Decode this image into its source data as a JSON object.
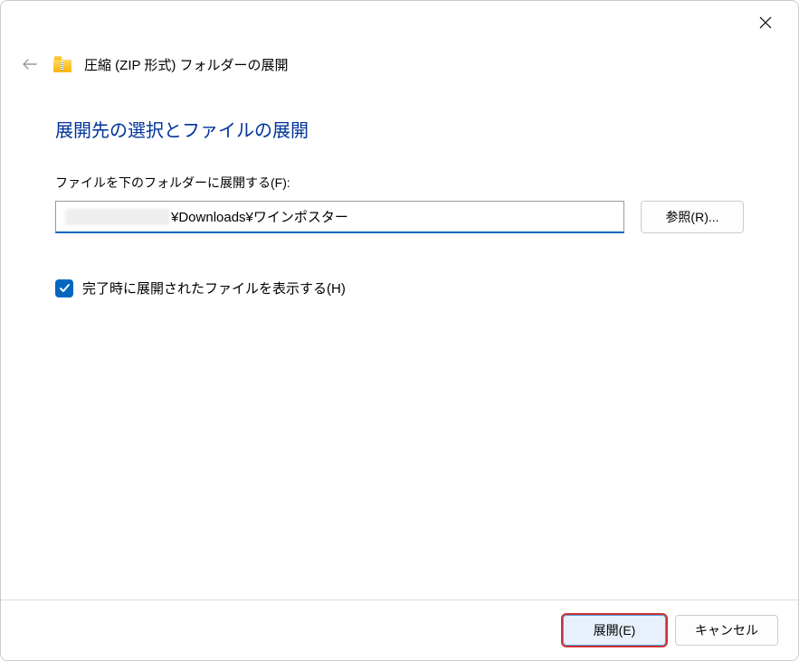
{
  "header": {
    "title": "圧縮 (ZIP 形式) フォルダーの展開"
  },
  "content": {
    "heading": "展開先の選択とファイルの展開",
    "path_label": "ファイルを下のフォルダーに展開する(F):",
    "path_value": "¥Downloads¥ワインポスター",
    "browse_label": "参照(R)...",
    "checkbox_label": "完了時に展開されたファイルを表示する(H)"
  },
  "footer": {
    "extract_label": "展開(E)",
    "cancel_label": "キャンセル"
  }
}
